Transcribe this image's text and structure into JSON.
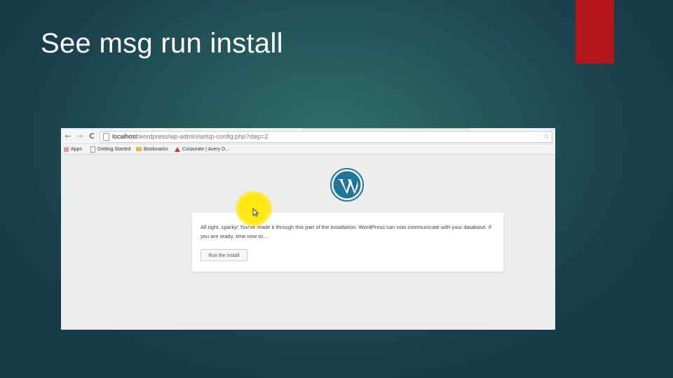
{
  "slide": {
    "title": "See msg run install",
    "accent_color": "#b3161a"
  },
  "browser": {
    "nav": {
      "back_icon": "back-arrow-icon",
      "forward_icon": "forward-arrow-icon",
      "reload_icon": "reload-icon",
      "back_glyph": "←",
      "forward_glyph": "→",
      "reload_glyph": "C"
    },
    "url": {
      "host": "localhost",
      "path": "/wordpress/wp-admin/setup-config.php?step=2"
    },
    "bookmark_icon": "star-icon",
    "bookmarks": [
      {
        "label": "Apps",
        "icon": "apps-icon"
      },
      {
        "label": "Getting Started",
        "icon": "page-icon"
      },
      {
        "label": "Bookmarks",
        "icon": "folder-icon"
      },
      {
        "label": "Corporate | Avery D...",
        "icon": "warning-icon"
      }
    ]
  },
  "page": {
    "logo": "wordpress-logo-icon",
    "brand_color": "#21759b",
    "message": "All right, sparky! You've made it through this part of the installation. WordPress can now communicate with your database. If you are ready, time now to…",
    "run_button_label": "Run the install",
    "highlight_color": "#ffe600"
  }
}
